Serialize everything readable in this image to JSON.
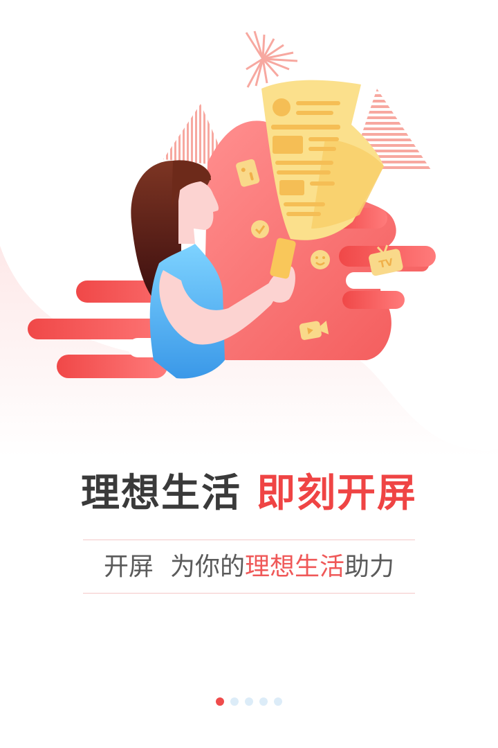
{
  "splash": {
    "headline": {
      "dark": "理想生活",
      "red": "即刻开屏"
    },
    "tagline": {
      "prefix": "开屏",
      "middle": "为你的",
      "highlight": "理想生活",
      "suffix": "助力"
    },
    "illustration": {
      "tv_sign_text": "TV"
    },
    "pagination": {
      "total": 5,
      "current_page": 1
    }
  },
  "colors": {
    "accent_red": "#ef4444",
    "headline_dark": "#3a3a3a",
    "dot_inactive": "#dcecf8",
    "paper_yellow": "#fbe08c"
  }
}
